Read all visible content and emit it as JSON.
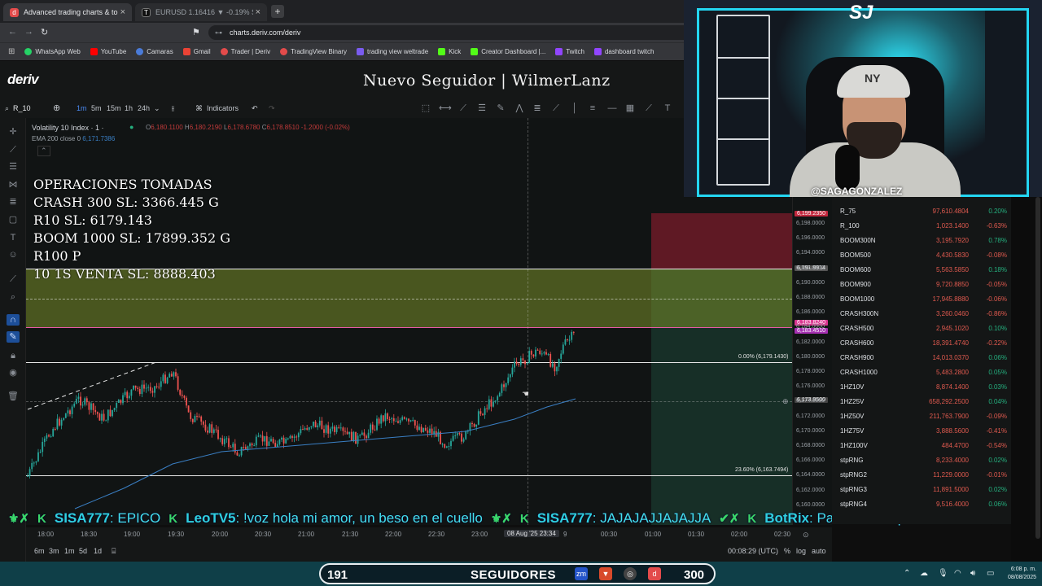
{
  "browser": {
    "tabs": [
      {
        "label": "Advanced trading charts & tool",
        "active": true
      },
      {
        "label": "EURUSD 1.16416 ▼ -0.19% Sagu",
        "active": false
      }
    ],
    "url": "charts.deriv.com/deriv",
    "bookmarks": [
      "WhatsApp Web",
      "YouTube",
      "Camaras",
      "Gmail",
      "Trader | Deriv",
      "TradingView Binary",
      "trading view weltrade",
      "Kick",
      "Creator Dashboard |...",
      "Twitch",
      "dashboard twitch"
    ]
  },
  "app": {
    "logo": "deriv",
    "overlay_title": "Nuevo Seguidor | WilmerLanz"
  },
  "toolbar": {
    "symbol": "R_10",
    "intervals": [
      "1m",
      "5m",
      "15m",
      "1h",
      "24h"
    ],
    "active_interval": "1m",
    "indicators_label": "Indicators"
  },
  "chart": {
    "title": "Volatility 10 Index · 1 ·",
    "ohlc": {
      "o": "6,180.1100",
      "h": "6,180.2190",
      "l": "6,178.6780",
      "c": "6,178.8510",
      "chg": "-1.2000 (-0.02%)"
    },
    "ema_label": "EMA 200 close 0",
    "ema_value": "6,171.7386",
    "operations": [
      "OPERACIONES TOMADAS",
      "CRASH 300 SL: 3366.445 G",
      "R10 SL: 6179.143",
      "BOOM 1000 SL: 17899.352 G",
      "R100 P",
      "10 1S VENTA SL: 8888.403"
    ],
    "fib_top": "0.00% (6,179.1430)",
    "fib_bottom": "23.60% (6,163.7494)",
    "price_labels": [
      "6,198.0000",
      "6,196.0000",
      "6,194.0000",
      "6,192.0000",
      "6,190.0000",
      "6,188.0000",
      "6,186.0000",
      "6,184.0000",
      "6,182.0000",
      "6,180.0000",
      "6,178.0000",
      "6,176.0000",
      "6,174.0000",
      "6,172.0000",
      "6,170.0000",
      "6,168.0000",
      "6,166.0000",
      "6,164.0000",
      "6,162.0000",
      "6,160.0000"
    ],
    "tags": {
      "red": "6,199.2350",
      "grey": "6,191.9914",
      "pink": "6,183.8240",
      "mag": "6,183.4510",
      "current": "6,173.9500"
    },
    "times": [
      "18:00",
      "18:30",
      "19:00",
      "19:30",
      "20:00",
      "20:30",
      "21:00",
      "21:30",
      "22:00",
      "22:30",
      "23:00",
      "08 Aug '25 23:34",
      "9",
      "00:30",
      "01:00",
      "01:30",
      "02:00",
      "02:30"
    ],
    "zoom": [
      "6m",
      "3m",
      "1m",
      "5d",
      "1d"
    ],
    "clock": "00:08:29 (UTC)",
    "scale_opts": [
      "%",
      "log",
      "auto"
    ],
    "colors": {
      "up": "#26a69a",
      "down": "#ef5350",
      "ema": "#3a7fc4",
      "zone_yellow": "#7a8c28",
      "zone_red": "#a01e32",
      "zone_green": "#28785a"
    }
  },
  "markets": [
    {
      "name": "R_75",
      "price": "97,610.4804",
      "change": "0.20%",
      "dir": "up"
    },
    {
      "name": "R_100",
      "price": "1,023.1400",
      "change": "-0.63%",
      "dir": "dn"
    },
    {
      "name": "BOOM300N",
      "price": "3,195.7920",
      "change": "0.78%",
      "dir": "up"
    },
    {
      "name": "BOOM500",
      "price": "4,430.5830",
      "change": "-0.08%",
      "dir": "dn"
    },
    {
      "name": "BOOM600",
      "price": "5,563.5850",
      "change": "0.18%",
      "dir": "up"
    },
    {
      "name": "BOOM900",
      "price": "9,720.8850",
      "change": "-0.05%",
      "dir": "dn"
    },
    {
      "name": "BOOM1000",
      "price": "17,945.8880",
      "change": "-0.06%",
      "dir": "dn"
    },
    {
      "name": "CRASH300N",
      "price": "3,260.0460",
      "change": "-0.86%",
      "dir": "dn"
    },
    {
      "name": "CRASH500",
      "price": "2,945.1020",
      "change": "0.10%",
      "dir": "up"
    },
    {
      "name": "CRASH600",
      "price": "18,391.4740",
      "change": "-0.22%",
      "dir": "dn"
    },
    {
      "name": "CRASH900",
      "price": "14,013.0370",
      "change": "0.06%",
      "dir": "up"
    },
    {
      "name": "CRASH1000",
      "price": "5,483.2800",
      "change": "0.05%",
      "dir": "up"
    },
    {
      "name": "1HZ10V",
      "price": "8,874.1400",
      "change": "0.03%",
      "dir": "up"
    },
    {
      "name": "1HZ25V",
      "price": "658,292.2500",
      "change": "0.04%",
      "dir": "up"
    },
    {
      "name": "1HZ50V",
      "price": "211,763.7900",
      "change": "-0.09%",
      "dir": "dn"
    },
    {
      "name": "1HZ75V",
      "price": "3,888.5600",
      "change": "-0.41%",
      "dir": "dn"
    },
    {
      "name": "1HZ100V",
      "price": "484.4700",
      "change": "-0.54%",
      "dir": "dn"
    },
    {
      "name": "stpRNG",
      "price": "8,233.4000",
      "change": "0.02%",
      "dir": "up"
    },
    {
      "name": "stpRNG2",
      "price": "11,229.0000",
      "change": "-0.01%",
      "dir": "dn"
    },
    {
      "name": "stpRNG3",
      "price": "11,891.5000",
      "change": "0.02%",
      "dir": "up"
    },
    {
      "name": "stpRNG4",
      "price": "9,516.4000",
      "change": "0.06%",
      "dir": "up"
    }
  ],
  "webcam": {
    "brand": "SJ",
    "handle": "@SAGAGONZALEZ",
    "cap": "NY"
  },
  "chat_ticker": [
    {
      "user": "SISA777",
      "msg": ": EPICO"
    },
    {
      "user": "LeoTV5",
      "msg": ": !voz hola mi amor, un beso en el cuello"
    },
    {
      "user": "SISA777",
      "msg": ": JAJAJAJJAJAJJA"
    },
    {
      "user": "BotRix",
      "msg": ": Para los ludopatas los comandos"
    }
  ],
  "followers": {
    "current": "191",
    "label": "SEGUIDORES",
    "goal": "300"
  },
  "taskbar": {
    "time": "6:08 p. m.",
    "date": "08/08/2025"
  }
}
